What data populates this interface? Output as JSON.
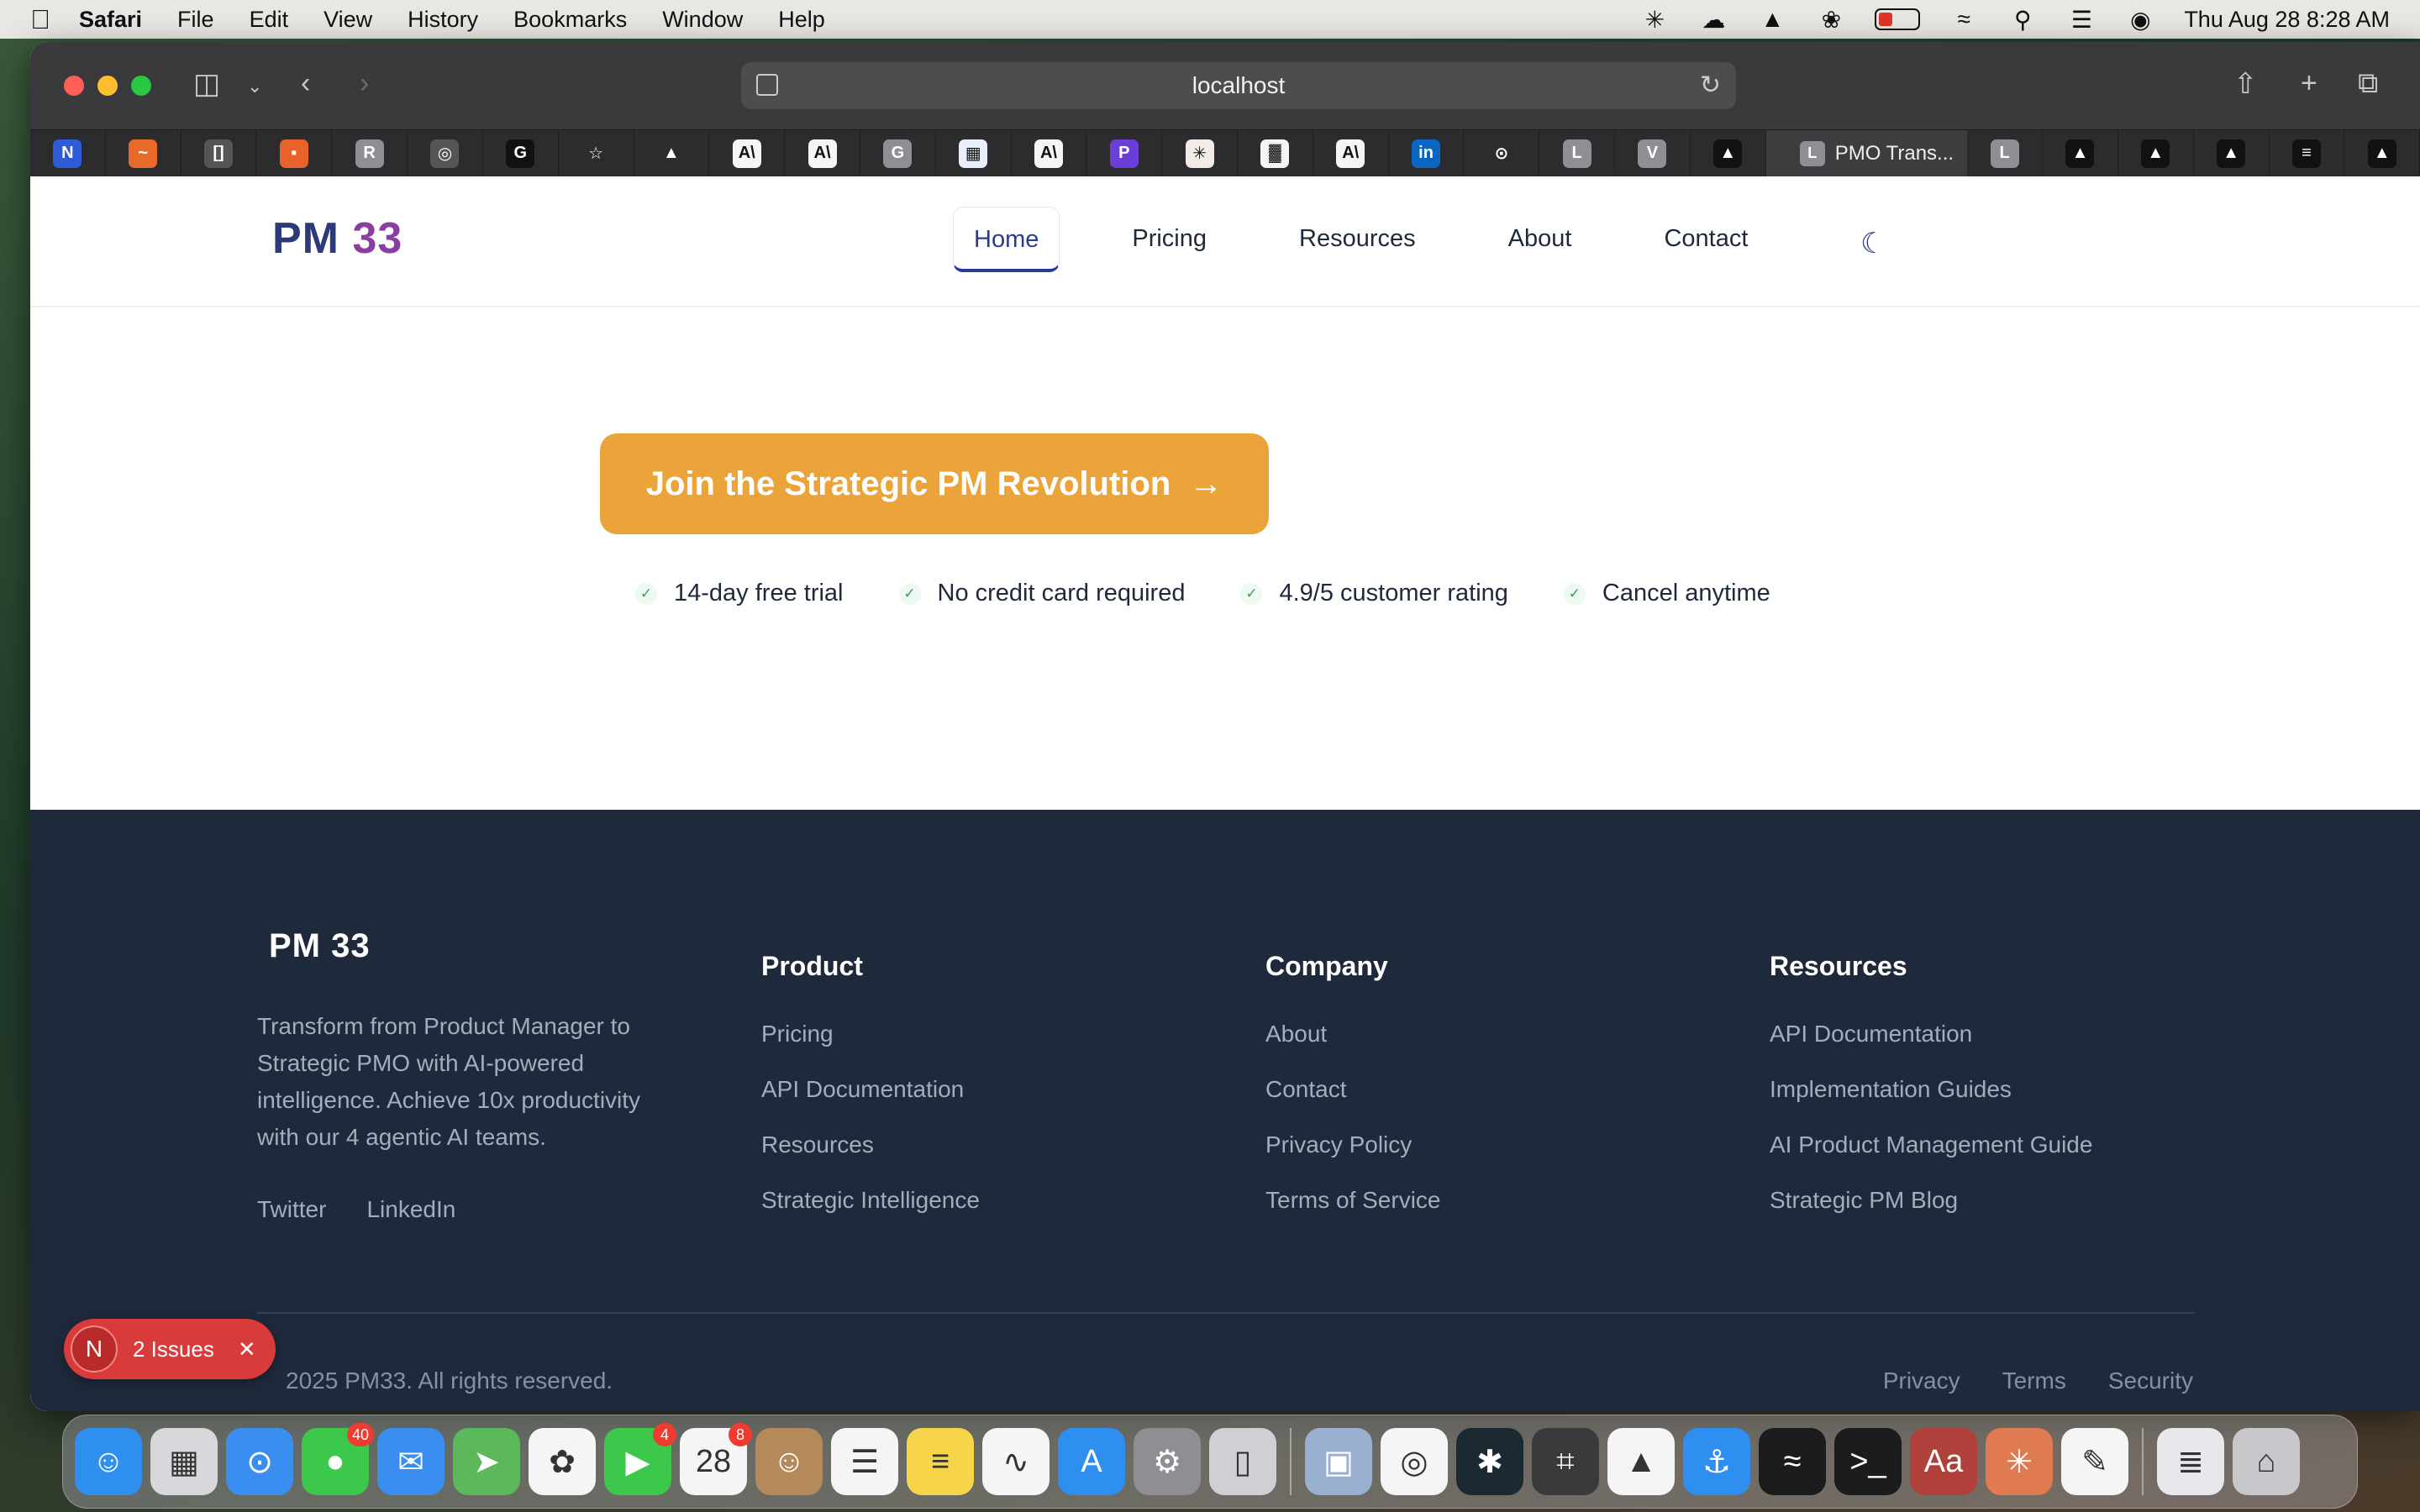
{
  "menubar": {
    "app": "Safari",
    "items": [
      "File",
      "Edit",
      "View",
      "History",
      "Bookmarks",
      "Window",
      "Help"
    ],
    "clock": "Thu Aug 28  8:28 AM"
  },
  "browser": {
    "url": "localhost",
    "active_tab_title": "PMO Trans...",
    "active_tab_letter": "L",
    "tabs": [
      {
        "icon": "notion-icon",
        "letter": "N",
        "color": "#2f5bd8"
      },
      {
        "icon": "grafana-icon",
        "letter": "~",
        "color": "#e86a2b"
      },
      {
        "icon": "screenshot-icon",
        "letter": "[]",
        "color": "#555"
      },
      {
        "icon": "dots-icon",
        "letter": "▪",
        "color": "#e8632b"
      },
      {
        "icon": "r-icon",
        "letter": "R",
        "color": "#8e8e93"
      },
      {
        "icon": "globe-icon",
        "letter": "◎",
        "color": "#555"
      },
      {
        "icon": "g-icon",
        "letter": "G",
        "color": "#111"
      },
      {
        "icon": "star-icon",
        "letter": "☆",
        "color": "#2c2c2e"
      },
      {
        "icon": "drive-icon",
        "letter": "▲",
        "color": "#2c2c2e"
      },
      {
        "icon": "anthropic-icon",
        "letter": "A\\",
        "color": "#f5f5f5"
      },
      {
        "icon": "anthropic-icon",
        "letter": "A\\",
        "color": "#f5f5f5"
      },
      {
        "icon": "g-icon",
        "letter": "G",
        "color": "#8e8e93"
      },
      {
        "icon": "grid-icon",
        "letter": "▦",
        "color": "#e8eefc"
      },
      {
        "icon": "anthropic-icon",
        "letter": "A\\",
        "color": "#f5f5f5"
      },
      {
        "icon": "p-icon",
        "letter": "P",
        "color": "#6a3fd8"
      },
      {
        "icon": "claude-icon",
        "letter": "✳",
        "color": "#f3ece6"
      },
      {
        "icon": "chart-icon",
        "letter": "▓",
        "color": "#f5f5f5"
      },
      {
        "icon": "anthropic-icon",
        "letter": "A\\",
        "color": "#f5f5f5"
      },
      {
        "icon": "linkedin-icon",
        "letter": "in",
        "color": "#0a66c2"
      },
      {
        "icon": "compass-icon",
        "letter": "⊙",
        "color": "#2c2c2e"
      },
      {
        "icon": "l-icon",
        "letter": "L",
        "color": "#8e8e93"
      },
      {
        "icon": "v-icon",
        "letter": "V",
        "color": "#8e8e93"
      },
      {
        "icon": "triangle-icon",
        "letter": "▲",
        "color": "#111"
      }
    ],
    "tabs_after": [
      {
        "icon": "l-icon",
        "letter": "L",
        "color": "#8e8e93"
      },
      {
        "icon": "triangle-icon",
        "letter": "▲",
        "color": "#111"
      },
      {
        "icon": "triangle-icon",
        "letter": "▲",
        "color": "#111"
      },
      {
        "icon": "triangle-icon",
        "letter": "▲",
        "color": "#111"
      },
      {
        "icon": "stack-icon",
        "letter": "≡",
        "color": "#111"
      },
      {
        "icon": "triangle-icon",
        "letter": "▲",
        "color": "#111"
      }
    ]
  },
  "site": {
    "logo_pm": "PM",
    "logo_33": "33",
    "nav": [
      "Home",
      "Pricing",
      "Resources",
      "About",
      "Contact"
    ],
    "cta": "Join the Strategic PM Revolution",
    "perks": [
      "14-day free trial",
      "No credit card required",
      "4.9/5 customer rating",
      "Cancel anytime"
    ]
  },
  "footer": {
    "logo": "PM 33",
    "about": "Transform from Product Manager to Strategic PMO with AI-powered intelligence. Achieve 10x productivity with our 4 agentic AI teams.",
    "social": [
      "Twitter",
      "LinkedIn"
    ],
    "columns": [
      {
        "title": "Product",
        "links": [
          "Pricing",
          "API Documentation",
          "Resources",
          "Strategic Intelligence"
        ]
      },
      {
        "title": "Company",
        "links": [
          "About",
          "Contact",
          "Privacy Policy",
          "Terms of Service"
        ]
      },
      {
        "title": "Resources",
        "links": [
          "API Documentation",
          "Implementation Guides",
          "AI Product Management Guide",
          "Strategic PM Blog"
        ]
      }
    ],
    "copyright": "2025 PM33. All rights reserved.",
    "legal": [
      "Privacy",
      "Terms",
      "Security"
    ]
  },
  "issues_badge": {
    "letter": "N",
    "label": "2 Issues"
  },
  "dock": [
    {
      "name": "finder-icon",
      "glyph": "☺",
      "color": "#2e8ff0"
    },
    {
      "name": "launchpad-icon",
      "glyph": "▦",
      "color": "#d8d8dc"
    },
    {
      "name": "safari-icon",
      "glyph": "⊙",
      "color": "#3a8ef0"
    },
    {
      "name": "messages-icon",
      "glyph": "●",
      "color": "#3cc84a",
      "badge": "40"
    },
    {
      "name": "mail-icon",
      "glyph": "✉",
      "color": "#3a8ef0"
    },
    {
      "name": "maps-icon",
      "glyph": "➤",
      "color": "#5bb85b"
    },
    {
      "name": "photos-icon",
      "glyph": "✿",
      "color": "#f5f5f5"
    },
    {
      "name": "facetime-icon",
      "glyph": "▶",
      "color": "#3cc84a",
      "badge": "4"
    },
    {
      "name": "calendar-icon",
      "glyph": "28",
      "color": "#f5f5f5",
      "badge": "8"
    },
    {
      "name": "contacts-icon",
      "glyph": "☺",
      "color": "#b58a5a"
    },
    {
      "name": "reminders-icon",
      "glyph": "☰",
      "color": "#f5f5f5"
    },
    {
      "name": "notes-icon",
      "glyph": "≡",
      "color": "#f7d54a"
    },
    {
      "name": "freeform-icon",
      "glyph": "∿",
      "color": "#f5f5f5"
    },
    {
      "name": "appstore-icon",
      "glyph": "A",
      "color": "#2e8ff0"
    },
    {
      "name": "settings-icon",
      "glyph": "⚙",
      "color": "#8e8e93"
    },
    {
      "name": "iphone-mirroring-icon",
      "glyph": "▯",
      "color": "#d0d0d4"
    },
    {
      "name": "preview-icon",
      "glyph": "▣",
      "color": "#9ab0d0"
    },
    {
      "name": "chrome-icon",
      "glyph": "◎",
      "color": "#f5f5f5"
    },
    {
      "name": "perplexity-icon",
      "glyph": "✱",
      "color": "#1a2a30"
    },
    {
      "name": "calculator-icon",
      "glyph": "⌗",
      "color": "#3a3a3c"
    },
    {
      "name": "nordvpn-icon",
      "glyph": "▲",
      "color": "#f5f5f5"
    },
    {
      "name": "docker-icon",
      "glyph": "⚓",
      "color": "#2e8ff0"
    },
    {
      "name": "activity-monitor-icon",
      "glyph": "≈",
      "color": "#1c1c1e"
    },
    {
      "name": "terminal-icon",
      "glyph": ">_",
      "color": "#1c1c1e"
    },
    {
      "name": "dictionary-icon",
      "glyph": "Aa",
      "color": "#b0403a"
    },
    {
      "name": "claude-icon",
      "glyph": "✳",
      "color": "#e07a50"
    },
    {
      "name": "textedit-icon",
      "glyph": "✎",
      "color": "#f5f5f5"
    },
    {
      "name": "document-icon",
      "glyph": "≣",
      "color": "#e8e8ec"
    },
    {
      "name": "trash-icon",
      "glyph": "⌂",
      "color": "#c8c8cc"
    }
  ]
}
